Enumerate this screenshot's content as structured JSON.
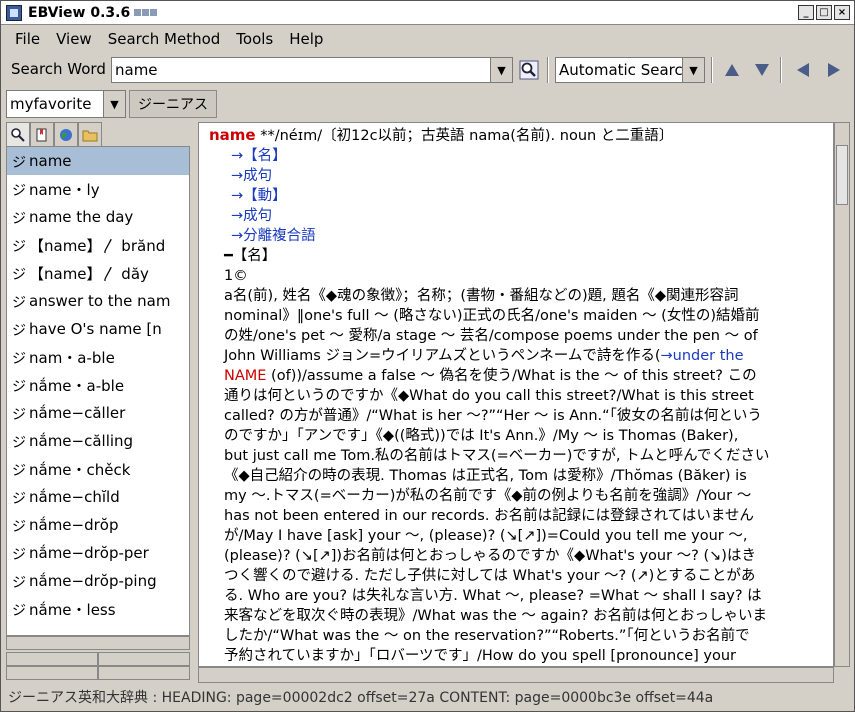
{
  "window": {
    "title": "EBView 0.3.6"
  },
  "menu": [
    "File",
    "View",
    "Search Method",
    "Tools",
    "Help"
  ],
  "search": {
    "label": "Search Word",
    "value": "name",
    "method": "Automatic Searcl"
  },
  "dictgroup": {
    "selected": "myfavorite",
    "dict_button": "ジーニアス"
  },
  "results": [
    {
      "mark": "ジ",
      "text": "name",
      "selected": true
    },
    {
      "mark": "ジ",
      "text": "name・ly"
    },
    {
      "mark": "ジ",
      "text": "name the day"
    },
    {
      "mark": "ジ",
      "text": "【name】〳 brănd"
    },
    {
      "mark": "ジ",
      "text": "【name】〳 dăy"
    },
    {
      "mark": "ジ",
      "text": "answer to the nam"
    },
    {
      "mark": "ジ",
      "text": "have O's name [n"
    },
    {
      "mark": "ジ",
      "text": "nam・a-ble"
    },
    {
      "mark": "ジ",
      "text": "nắme・a-ble"
    },
    {
      "mark": "ジ",
      "text": "nắme−căller"
    },
    {
      "mark": "ジ",
      "text": "nắme−călling"
    },
    {
      "mark": "ジ",
      "text": "nắme・chěck"
    },
    {
      "mark": "ジ",
      "text": "nắme−chĭld"
    },
    {
      "mark": "ジ",
      "text": "nắme−drŏp"
    },
    {
      "mark": "ジ",
      "text": "nắme−drŏp-per"
    },
    {
      "mark": "ジ",
      "text": "nắme−drŏp-ping"
    },
    {
      "mark": "ジ",
      "text": "nắme・less"
    }
  ],
  "entry": {
    "headword": "name",
    "pron": " **/néɪm/〔初12c以前；古英語 nama(名前). noun と二重語〕",
    "links": [
      "→【名】",
      "→成句",
      "→【動】",
      "→成句",
      "→分離複合語"
    ],
    "pos": "━【名】",
    "sense": "1©",
    "lines": [
      "a名(前), 姓名《◆魂の象徴》；名称；(書物・番組などの)題, 題名《◆関連形容詞",
      "nominal》‖one's full 〜 (略さない)正式の氏名/one's maiden 〜 (女性の)結婚前",
      "の姓/one's pet 〜 愛称/a stage 〜 芸名/compose poems under the pen 〜 of",
      "John Williams ジョン=ウイリアムズというペンネームで詩を作る(",
      "NAME (of))/assume a false 〜 偽名を使う/What is the 〜 of this street? この",
      "通りは何というのですか《◆What do you call this street?/What is this street",
      "called? の方が普通》/“What is her 〜?”“Her 〜 is Ann.“「彼女の名前は何という",
      "のですか」「アンです」《◆((略式))では It's Ann.》/My 〜 is Thomas (Baker),",
      "but just call me Tom.私の名前はトマス(=ベーカー)ですが, トムと呼んでください",
      "《◆自己紹介の時の表現. Thomas は正式名, Tom は愛称》/Thŏmas (Băker) is",
      "my 〜.トマス(=ベーカー)が私の名前です《◆前の例よりも名前を強調》/Your 〜",
      "has not been entered in our records. お名前は記録には登録されてはいません",
      "が/May I have [ask] your 〜, (please)? (↘[↗])=Could you tell me your 〜,",
      "(please)? (↘[↗])お名前は何とおっしゃるのですか《◆What's your 〜? (↘)はき",
      "つく響くので避ける. ただし子供に対しては What's your 〜? (↗)とすることがあ",
      "る. Who are you? は失礼な言い方. What 〜, please? =What 〜 shall I say? は",
      "来客などを取次ぐ時の表現》/What was the 〜 again? お名前は何とおっしゃいま",
      "したか/“What was the 〜 on the reservation?”“Roberts.”「何というお名前で",
      "予約されていますか」「ロバーツです」/How do you spell [pronounce] your"
    ],
    "inline_link": "→under the",
    "inline_red": "NAME"
  },
  "status": "ジーニアス英和大辞典 : HEADING: page=00002dc2 offset=27a   CONTENT: page=0000bc3e offset=44a",
  "icons": {
    "search_icon": "magnifier-icon",
    "tabs": [
      "search-tab-icon",
      "bookmark-tab-icon",
      "globe-tab-icon",
      "folder-tab-icon"
    ]
  }
}
